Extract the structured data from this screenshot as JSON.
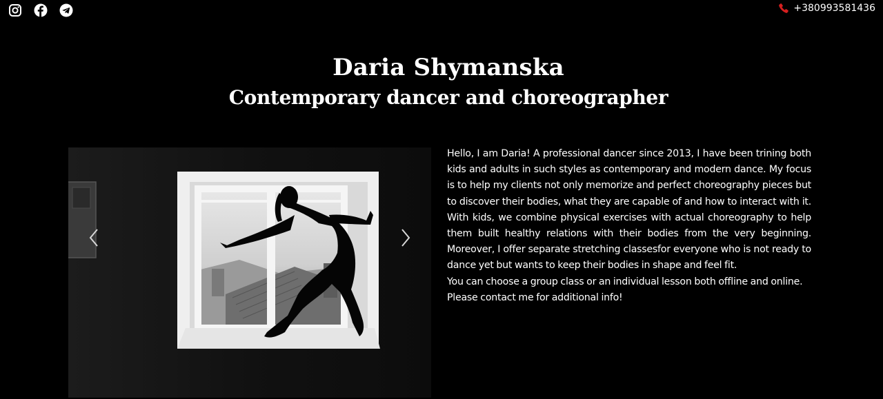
{
  "topbar": {
    "socials": [
      {
        "icon": "instagram-icon"
      },
      {
        "icon": "facebook-icon"
      },
      {
        "icon": "telegram-icon"
      }
    ],
    "phone_icon": "phone-icon",
    "phone_number": "+380993581436",
    "phone_icon_color": "#d61f1f"
  },
  "hero": {
    "name": "Daria Shymanska",
    "subtitle": "Contemporary dancer and choreographer"
  },
  "carousel": {
    "prev_icon": "chevron-left-icon",
    "next_icon": "chevron-right-icon"
  },
  "bio": {
    "paragraph_1": "Hello, I am Daria! A professional dancer since 2013, I have been trining both kids and adults in such styles as contemporary and modern dance. My focus is to help my clients not only memorize and perfect choreography pieces but to discover their bodies, what they are capable of and how to interact with it. With kids, we combine physical exercises with actual choreography to help them built healthy relations with their bodies from the very beginning. Moreover, I offer separate stretching classesfor everyone who is not ready to dance yet but wants to keep their bodies in shape and feel fit.",
    "paragraph_2": "You can choose a group class or an individual lesson both offline and online.",
    "paragraph_3": "Please contact me for additional info!"
  },
  "colors": {
    "background": "#000000",
    "text": "#ffffff",
    "accent": "#d61f1f"
  }
}
